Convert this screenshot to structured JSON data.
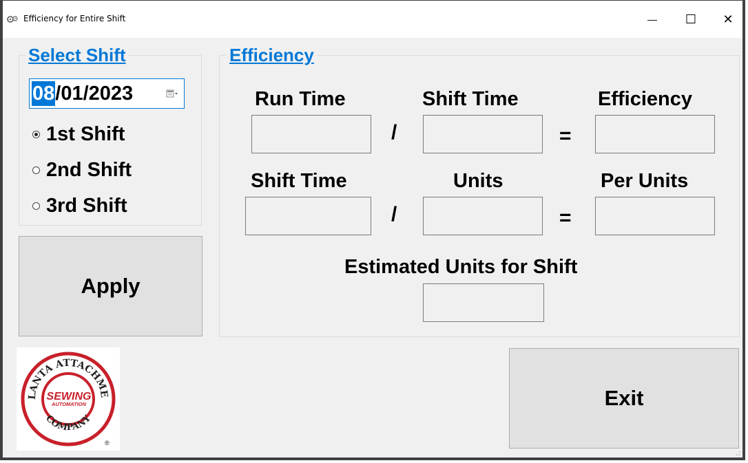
{
  "window": {
    "title": "Efficiency for Entire Shift",
    "minimize": "—",
    "maximize": "☐",
    "close": "✕"
  },
  "select_shift": {
    "title": "Select Shift",
    "date_month": "08",
    "date_rest": "/01/2023",
    "options": [
      {
        "label": "1st Shift",
        "checked": true
      },
      {
        "label": "2nd Shift",
        "checked": false
      },
      {
        "label": "3rd Shift",
        "checked": false
      }
    ]
  },
  "apply_label": "Apply",
  "exit_label": "Exit",
  "efficiency": {
    "title": "Efficiency",
    "row1": {
      "a": "Run Time",
      "b": "Shift Time",
      "c": "Efficiency"
    },
    "row2": {
      "a": "Shift Time",
      "b": "Units",
      "c": "Per Units"
    },
    "divide": "/",
    "equals": "=",
    "estimated_label": "Estimated Units for Shift",
    "fields": {
      "run_time": "",
      "shift_time": "",
      "efficiency": "",
      "shift_time2": "",
      "units": "",
      "per_units": "",
      "estimated_units": ""
    }
  },
  "logo": {
    "text_top": "ATLANTA ATTACHMENT",
    "text_bottom": "COMPANY",
    "center_line1": "SEWING",
    "center_line2": "AUTOMATION",
    "registered": "®",
    "colors": {
      "ring": "#c8202a",
      "text": "#222222"
    }
  }
}
